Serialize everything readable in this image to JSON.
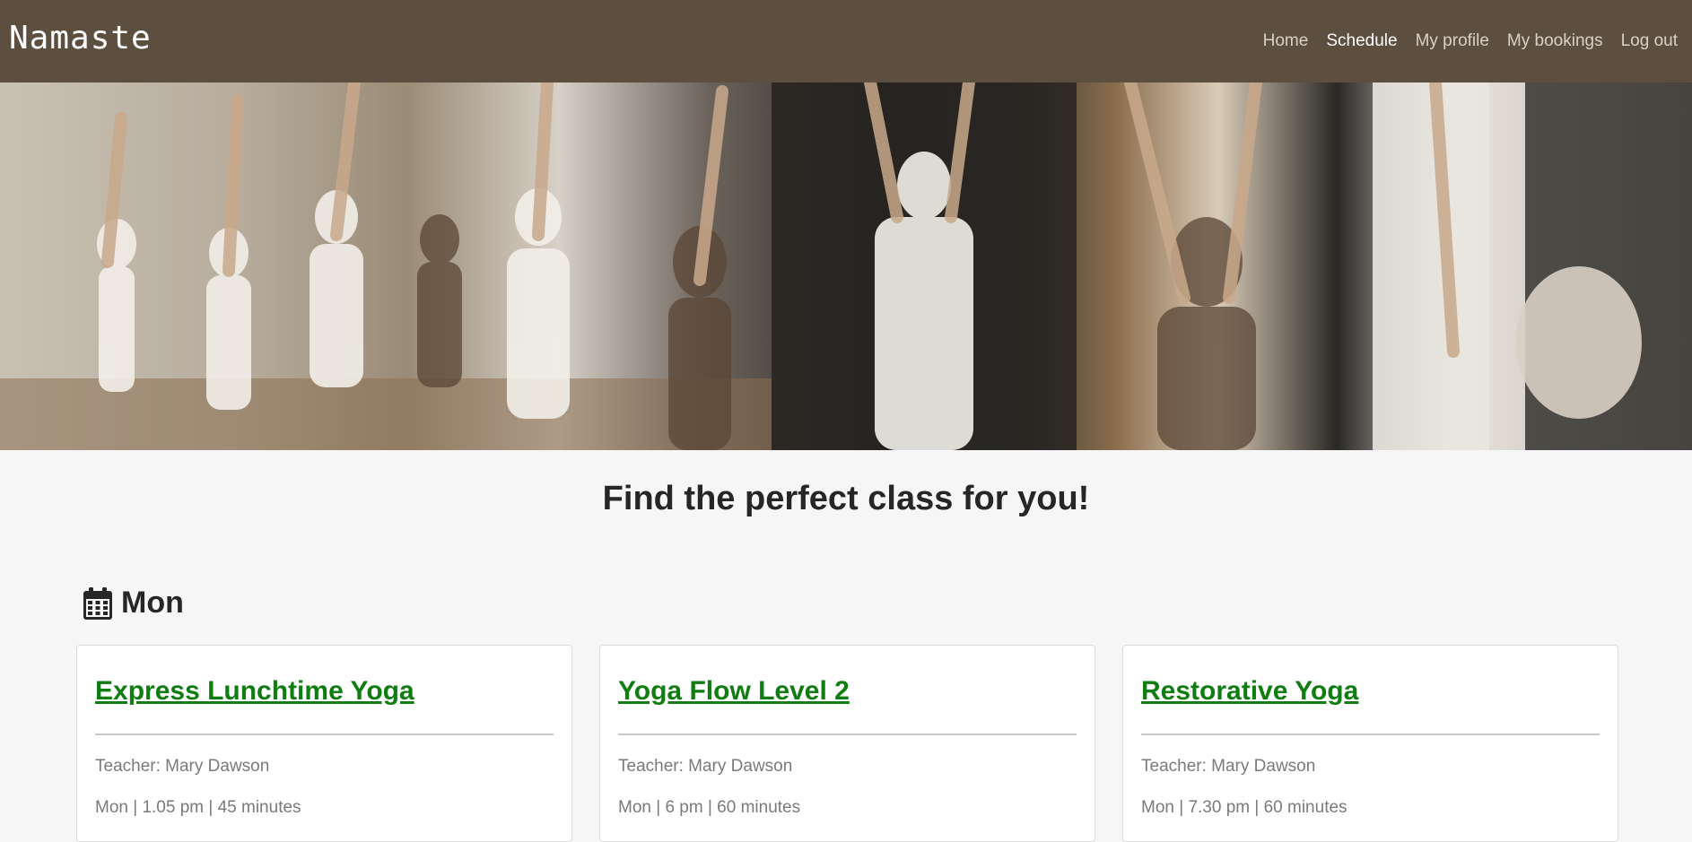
{
  "navbar": {
    "brand": "Namaste",
    "links": [
      {
        "label": "Home",
        "active": false
      },
      {
        "label": "Schedule",
        "active": true
      },
      {
        "label": "My profile",
        "active": false
      },
      {
        "label": "My bookings",
        "active": false
      },
      {
        "label": "Log out",
        "active": false
      }
    ],
    "background_color": "#5d4f3f"
  },
  "hero": {
    "image": "yoga-class-photo"
  },
  "main": {
    "heading": "Find the perfect class for you!",
    "day": {
      "label": "Mon",
      "icon": "calendar-icon"
    },
    "classes": [
      {
        "title": "Express Lunchtime Yoga",
        "teacher": "Teacher: Mary Dawson",
        "meta": "Mon | 1.05 pm | 45 minutes"
      },
      {
        "title": "Yoga Flow Level 2",
        "teacher": "Teacher: Mary Dawson",
        "meta": "Mon | 6 pm | 60 minutes"
      },
      {
        "title": "Restorative Yoga",
        "teacher": "Teacher: Mary Dawson",
        "meta": "Mon | 7.30 pm | 60 minutes"
      }
    ],
    "link_color": "#0f7d0f"
  }
}
